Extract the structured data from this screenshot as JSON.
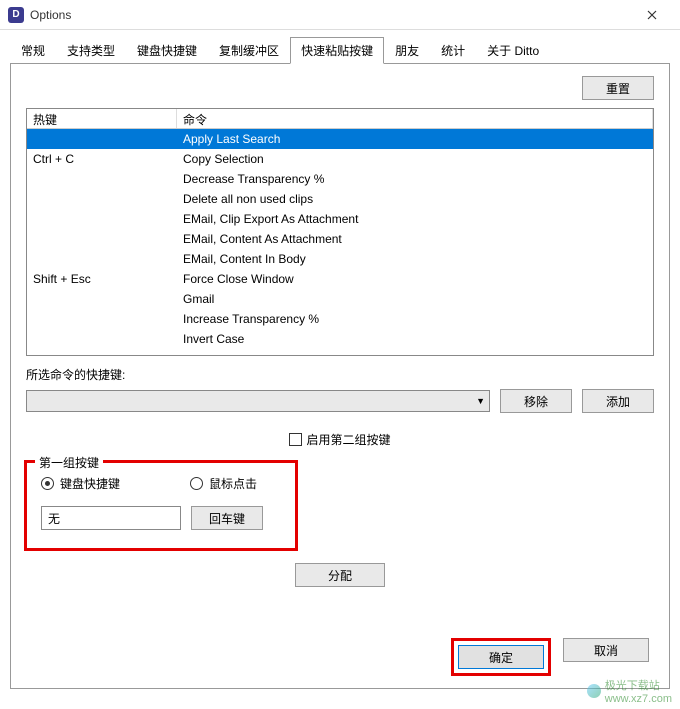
{
  "window": {
    "title": "Options",
    "icon_label": "D"
  },
  "tabs": [
    {
      "label": "常规"
    },
    {
      "label": "支持类型"
    },
    {
      "label": "键盘快捷键"
    },
    {
      "label": "复制缓冲区"
    },
    {
      "label": "快速粘贴按键"
    },
    {
      "label": "朋友"
    },
    {
      "label": "统计"
    },
    {
      "label": "关于 Ditto"
    }
  ],
  "active_tab_index": 4,
  "buttons": {
    "reset": "重置",
    "remove": "移除",
    "add": "添加",
    "assign": "分配",
    "ok": "确定",
    "cancel": "取消",
    "enter_key": "回车键"
  },
  "table": {
    "columns": {
      "hotkey": "热键",
      "command": "命令"
    },
    "rows": [
      {
        "hotkey": "",
        "command": "Apply Last Search",
        "selected": true
      },
      {
        "hotkey": "Ctrl + C",
        "command": "Copy Selection"
      },
      {
        "hotkey": "",
        "command": "Decrease Transparency %"
      },
      {
        "hotkey": "",
        "command": "Delete all non used clips"
      },
      {
        "hotkey": "",
        "command": "EMail, Clip Export As Attachment"
      },
      {
        "hotkey": "",
        "command": "EMail, Content As Attachment"
      },
      {
        "hotkey": "",
        "command": "EMail, Content In Body"
      },
      {
        "hotkey": "Shift + Esc",
        "command": "Force Close Window"
      },
      {
        "hotkey": "",
        "command": "Gmail"
      },
      {
        "hotkey": "",
        "command": "Increase Transparency %"
      },
      {
        "hotkey": "",
        "command": "Invert Case"
      }
    ]
  },
  "labels": {
    "selected_cmd_hotkey": "所选命令的快捷键:",
    "enable_second_group": "启用第二组按键",
    "first_group": "第一组按键",
    "keyboard_shortcut": "键盘快捷键",
    "mouse_click": "鼠标点击"
  },
  "input": {
    "value": "无"
  },
  "watermark": {
    "text": "极光下载站",
    "url": "www.xz7.com"
  }
}
